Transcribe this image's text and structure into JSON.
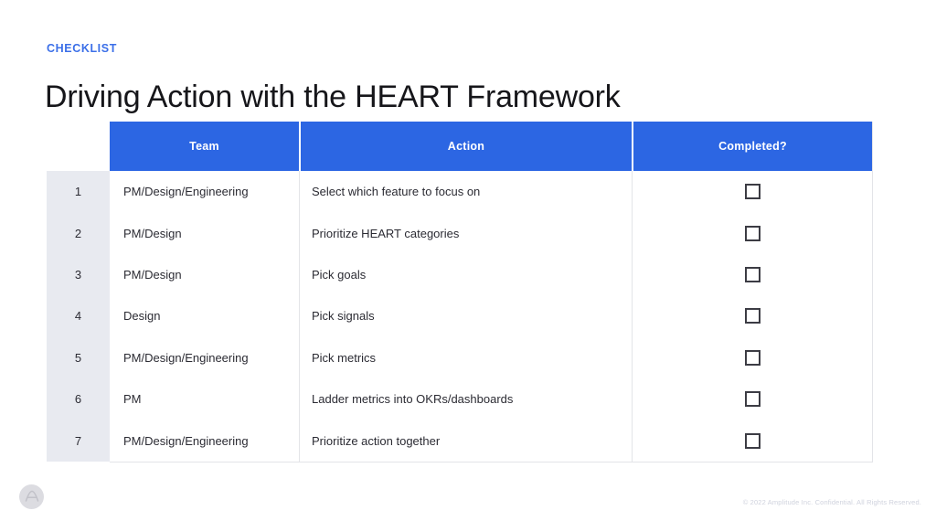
{
  "slide": {
    "eyebrow": "CHECKLIST",
    "title": "Driving Action with the HEART Framework",
    "footer_note": "© 2022 Amplitude Inc.  Confidential.  All Rights Reserved.",
    "logo_name": "amplitude-logo",
    "colors": {
      "accent_blue": "#2c66e3",
      "eyebrow_blue": "#3b6fe8",
      "index_column_bg": "#e8eaf0",
      "text": "#2b2b33",
      "border": "#e3e4e8",
      "footer_text": "#cfd2dd"
    }
  },
  "table": {
    "columns": [
      "Team",
      "Action",
      "Completed?"
    ],
    "rows": [
      {
        "index": "1",
        "team": "PM/Design/Engineering",
        "action": "Select which feature to focus on",
        "completed": false
      },
      {
        "index": "2",
        "team": "PM/Design",
        "action": "Prioritize HEART categories",
        "completed": false
      },
      {
        "index": "3",
        "team": "PM/Design",
        "action": "Pick goals",
        "completed": false
      },
      {
        "index": "4",
        "team": "Design",
        "action": "Pick signals",
        "completed": false
      },
      {
        "index": "5",
        "team": "PM/Design/Engineering",
        "action": "Pick metrics",
        "completed": false
      },
      {
        "index": "6",
        "team": "PM",
        "action": "Ladder metrics into OKRs/dashboards",
        "completed": false
      },
      {
        "index": "7",
        "team": "PM/Design/Engineering",
        "action": "Prioritize action together",
        "completed": false
      }
    ]
  }
}
